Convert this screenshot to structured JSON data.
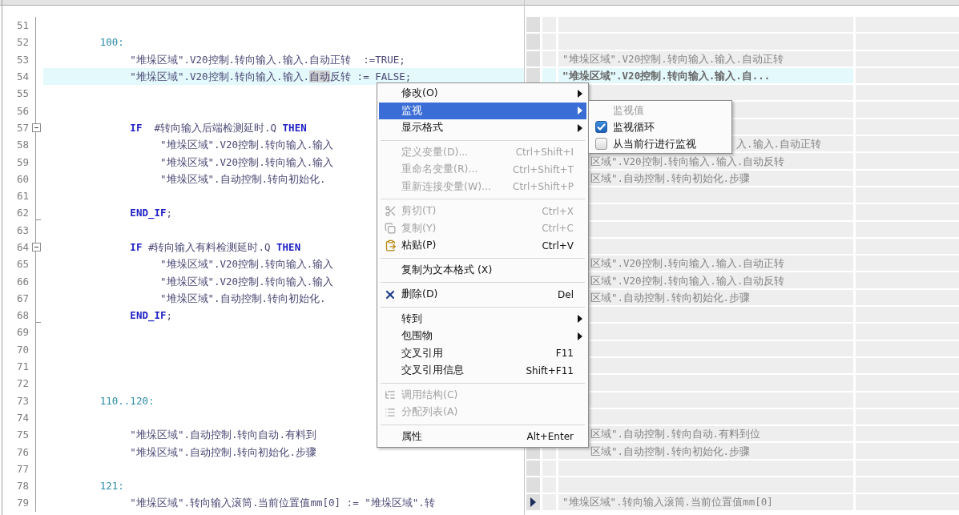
{
  "lines": [
    {
      "number": "51",
      "current": false,
      "marker": false
    },
    {
      "number": "52",
      "current": false,
      "marker": false,
      "tokens": [
        {
          "kind": "label",
          "text": "         100:"
        }
      ]
    },
    {
      "number": "53",
      "current": false,
      "marker": false,
      "tokens": [
        {
          "kind": "plain",
          "text": "              \"堆垛区域\".V20控制.转向输入.输入.自动正转  :=TRUE;"
        }
      ],
      "monitor": "\"堆垛区域\".V20控制.转向输入.输入.自动正转"
    },
    {
      "number": "54",
      "current": true,
      "marker": false,
      "tokens": [
        {
          "kind": "plain",
          "text": "              \"堆垛区域\".V20控制.转向输入.输入."
        },
        {
          "kind": "selected",
          "text": "自动"
        },
        {
          "kind": "plain",
          "text": "反转 := FALSE;"
        }
      ],
      "monitor": "\"堆垛区域\".V20控制.转向输入.输入.自..."
    },
    {
      "number": "55",
      "current": false
    },
    {
      "number": "56",
      "current": false
    },
    {
      "number": "57",
      "current": false,
      "tokens": [
        {
          "kind": "keyword",
          "text": "              IF"
        },
        {
          "kind": "plain",
          "text": "  #转向输入后端检测延时.Q "
        },
        {
          "kind": "keyword",
          "text": "THEN"
        }
      ]
    },
    {
      "number": "58",
      "current": false,
      "tokens": [
        {
          "kind": "plain",
          "text": "                   \"堆垛区域\".V20控制.转向输入.输入"
        }
      ],
      "monitor": "入.输入.自动正转"
    },
    {
      "number": "59",
      "current": false,
      "tokens": [
        {
          "kind": "plain",
          "text": "                   \"堆垛区域\".V20控制.转向输入.输入"
        }
      ],
      "monitor": "区域\".V20控制.转向输入.输入.自动反转"
    },
    {
      "number": "60",
      "current": false,
      "tokens": [
        {
          "kind": "plain",
          "text": "                   \"堆垛区域\".自动控制.转向初始化."
        }
      ],
      "monitor": "区域\".自动控制.转向初始化.步骤"
    },
    {
      "number": "61",
      "current": false
    },
    {
      "number": "62",
      "current": false,
      "tokens": [
        {
          "kind": "keyword",
          "text": "              END_IF"
        },
        {
          "kind": "plain",
          "text": ";"
        }
      ]
    },
    {
      "number": "63",
      "current": false
    },
    {
      "number": "64",
      "current": false,
      "tokens": [
        {
          "kind": "keyword",
          "text": "              IF"
        },
        {
          "kind": "plain",
          "text": " #转向输入有料检测延时.Q "
        },
        {
          "kind": "keyword",
          "text": "THEN"
        }
      ]
    },
    {
      "number": "65",
      "current": false,
      "tokens": [
        {
          "kind": "plain",
          "text": "                   \"堆垛区域\".V20控制.转向输入.输入"
        }
      ],
      "monitor": "区域\".V20控制.转向输入.输入.自动正转"
    },
    {
      "number": "66",
      "current": false,
      "tokens": [
        {
          "kind": "plain",
          "text": "                   \"堆垛区域\".V20控制.转向输入.输入"
        }
      ],
      "monitor": "区域\".V20控制.转向输入.输入.自动反转"
    },
    {
      "number": "67",
      "current": false,
      "tokens": [
        {
          "kind": "plain",
          "text": "                   \"堆垛区域\".自动控制.转向初始化."
        }
      ],
      "monitor": "区域\".自动控制.转向初始化.步骤"
    },
    {
      "number": "68",
      "current": false,
      "tokens": [
        {
          "kind": "keyword",
          "text": "              END_IF"
        },
        {
          "kind": "plain",
          "text": ";"
        }
      ]
    },
    {
      "number": "69",
      "current": false
    },
    {
      "number": "70",
      "current": false
    },
    {
      "number": "71",
      "current": false
    },
    {
      "number": "72",
      "current": false
    },
    {
      "number": "73",
      "current": false,
      "tokens": [
        {
          "kind": "label",
          "text": "         110..120:"
        }
      ]
    },
    {
      "number": "74",
      "current": false
    },
    {
      "number": "75",
      "current": false,
      "tokens": [
        {
          "kind": "plain",
          "text": "              \"堆垛区域\".自动控制.转向自动.有料到"
        }
      ],
      "monitor": "区域\".自动控制.转向自动.有料到位"
    },
    {
      "number": "76",
      "current": false,
      "tokens": [
        {
          "kind": "plain",
          "text": "              \"堆垛区域\".自动控制.转向初始化.步骤"
        }
      ],
      "monitor": "区域\".自动控制.转向初始化.步骤"
    },
    {
      "number": "77",
      "current": false,
      "marker": false
    },
    {
      "number": "78",
      "current": false,
      "marker": false,
      "tokens": [
        {
          "kind": "label",
          "text": "         121:"
        }
      ]
    },
    {
      "number": "79",
      "current": false,
      "marker": true,
      "tokens": [
        {
          "kind": "plain",
          "text": "              \"堆垛区域\".转向输入滚筒.当前位置值mm[0] := \"堆垛区域\".转"
        }
      ],
      "monitor": "\"堆垛区域\".转向输入滚筒.当前位置值mm[0]"
    }
  ],
  "menu": {
    "items": [
      {
        "kind": "item",
        "label": "修改(O)",
        "submenu": true,
        "disabled": false,
        "selected": false
      },
      {
        "kind": "item",
        "label": "监视",
        "submenu": true,
        "disabled": false,
        "selected": true
      },
      {
        "kind": "item",
        "label": "显示格式",
        "submenu": true,
        "disabled": false,
        "selected": false
      },
      {
        "kind": "separator"
      },
      {
        "kind": "item",
        "label": "定义变量(D)...",
        "shortcut": "Ctrl+Shift+I",
        "disabled": true,
        "selected": false
      },
      {
        "kind": "item",
        "label": "重命名变量(R)...",
        "shortcut": "Ctrl+Shift+T",
        "disabled": true,
        "selected": false
      },
      {
        "kind": "item",
        "label": "重新连接变量(W)...",
        "shortcut": "Ctrl+Shift+P",
        "disabled": true,
        "selected": false
      },
      {
        "kind": "separator"
      },
      {
        "kind": "item",
        "label": "剪切(T)",
        "shortcut": "Ctrl+X",
        "disabled": true,
        "selected": false
      },
      {
        "kind": "item",
        "label": "复制(Y)",
        "shortcut": "Ctrl+C",
        "disabled": true,
        "selected": false
      },
      {
        "kind": "item",
        "label": "粘贴(P)",
        "shortcut": "Ctrl+V",
        "disabled": false,
        "selected": false
      },
      {
        "kind": "separator"
      },
      {
        "kind": "item",
        "label": "复制为文本格式 (X)",
        "disabled": false,
        "selected": false
      },
      {
        "kind": "separator"
      },
      {
        "kind": "item",
        "label": "删除(D)",
        "shortcut": "Del",
        "disabled": false,
        "selected": false
      },
      {
        "kind": "separator"
      },
      {
        "kind": "item",
        "label": "转到",
        "submenu": true,
        "disabled": false,
        "selected": false
      },
      {
        "kind": "item",
        "label": "包围物",
        "submenu": true,
        "disabled": false,
        "selected": false
      },
      {
        "kind": "item",
        "label": "交叉引用",
        "shortcut": "F11",
        "disabled": false,
        "selected": false
      },
      {
        "kind": "item",
        "label": "交叉引用信息",
        "shortcut": "Shift+F11",
        "disabled": false,
        "selected": false
      },
      {
        "kind": "separator"
      },
      {
        "kind": "item",
        "label": "调用结构(C)",
        "disabled": true,
        "selected": false
      },
      {
        "kind": "item",
        "label": "分配列表(A)",
        "disabled": true,
        "selected": false
      },
      {
        "kind": "separator"
      },
      {
        "kind": "item",
        "label": "属性",
        "shortcut": "Alt+Enter",
        "disabled": false,
        "selected": false
      }
    ]
  },
  "submenu": {
    "items": [
      {
        "kind": "item",
        "label": "监视值",
        "disabled": true
      },
      {
        "kind": "checkbox",
        "label": "监视循环",
        "checked": true,
        "disabled": false
      },
      {
        "kind": "checkbox",
        "label": "从当前行进行监视",
        "checked": false,
        "disabled": false
      }
    ]
  }
}
